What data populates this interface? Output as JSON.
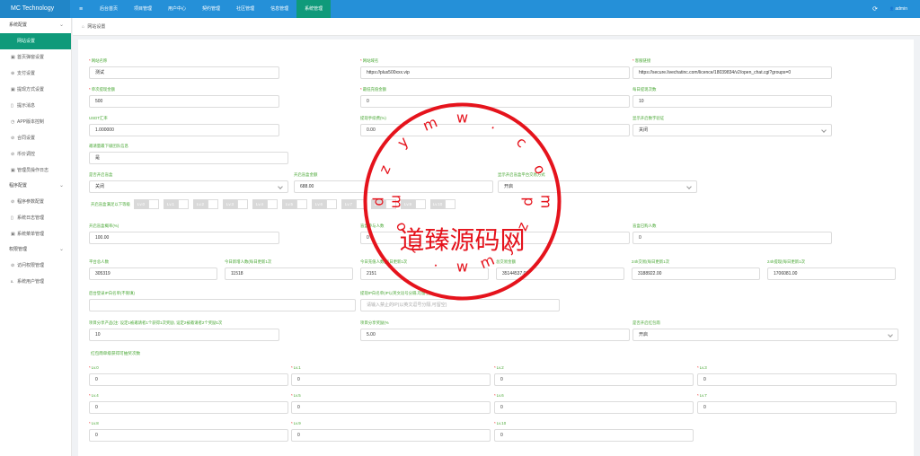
{
  "app": {
    "brand": "MC Technology",
    "menu_icon": "≡"
  },
  "nav": {
    "items": [
      "后台首页",
      "项目管理",
      "用户中心",
      "契约管理",
      "社区管理",
      "信息管理",
      "系统管理"
    ],
    "active_index": 6
  },
  "topright": {
    "refresh_icon": "⟳",
    "user": "admin",
    "user_icon": "👤"
  },
  "sidebar": {
    "group1": "系统配置",
    "items1": [
      {
        "label": "网站设置",
        "icon": "",
        "active": true
      },
      {
        "label": "首页弹窗设置",
        "icon": "▣"
      },
      {
        "label": "支付设置",
        "icon": "⊕"
      },
      {
        "label": "提现方式设置",
        "icon": "▣"
      },
      {
        "label": "提示消息",
        "icon": "▯"
      },
      {
        "label": "APP版本控制",
        "icon": "◷"
      },
      {
        "label": "合同设置",
        "icon": "⊘"
      },
      {
        "label": "币价调控",
        "icon": "⊘"
      },
      {
        "label": "管理员操作日志",
        "icon": "▣"
      }
    ],
    "group2": "程序配置",
    "items2": [
      {
        "label": "程序参数配置",
        "icon": "⊘"
      },
      {
        "label": "系统日志管理",
        "icon": "▯"
      },
      {
        "label": "系统菜单管理",
        "icon": "▣"
      }
    ],
    "group3": "权限管理",
    "items3": [
      {
        "label": "访问权限管理",
        "icon": "⊘"
      },
      {
        "label": "系统用户管理",
        "icon": "ఽ"
      }
    ]
  },
  "tab": {
    "label": "网站设置",
    "icon": "⌂"
  },
  "form": {
    "row1": [
      {
        "label": "网站名称",
        "req": true,
        "value": "测试"
      },
      {
        "label": "网站域名",
        "req": true,
        "value": "https://plus500xxx.vip"
      },
      {
        "label": "客服链接",
        "req": true,
        "value": "https://secure.livechatinc.com/licence/18039834/v2/open_chat.cgi?groups=0"
      }
    ],
    "row2": [
      {
        "label": "单次提现金额",
        "req": true,
        "value": "500"
      },
      {
        "label": "最低充值金额",
        "req": true,
        "value": "0"
      },
      {
        "label": "每日提现次数",
        "req": false,
        "value": "10"
      }
    ],
    "row3": [
      {
        "label": "USDT汇率",
        "req": false,
        "value": "1.000000"
      },
      {
        "label": "提现手续费(%)",
        "req": false,
        "value": "0.00"
      },
      {
        "label": "显示开启数字验证",
        "req": false,
        "value": "关闭",
        "select": true
      }
    ],
    "row4": {
      "label": "邀请量最下级团队信息",
      "value": "是"
    },
    "row5": [
      {
        "label": "是否开启盲盒",
        "value": "关闭",
        "select": true
      },
      {
        "label": "开启盲盒金额",
        "value": "688.00"
      },
      {
        "label": "显示开启盲盒平台交易方式",
        "value": "开启",
        "select": true
      }
    ],
    "tags": {
      "label": "开启盲盒满足以下等级",
      "items": [
        "Lv.0",
        "Lv.1",
        "Lv.2",
        "Lv.3",
        "Lv.4",
        "Lv.5",
        "Lv.6",
        "Lv.7",
        "Lv.8",
        "Lv.9",
        "Lv.10"
      ]
    },
    "row6": [
      {
        "label": "开启盲盒概率(%)",
        "value": "100.00"
      },
      {
        "label": "盲盒参与人数",
        "value": "0"
      },
      {
        "label": "盲盒已购人数",
        "value": "0"
      }
    ],
    "row7": [
      {
        "label": "平台总人数",
        "value": "305319"
      },
      {
        "label": "今日新增人数(每日更新1次",
        "value": "11518"
      },
      {
        "label": "今日充值人数(每日更新1次",
        "value": "2151"
      },
      {
        "label": "总交易金额",
        "value": "35144537.00"
      },
      {
        "label": "24h交易(每日更新1次",
        "value": "3188922.00"
      },
      {
        "label": "24h提现(每日更新1次",
        "value": "1706081.00"
      }
    ],
    "row8": [
      {
        "label": "后台登录IP白名单(不限填)",
        "value": ""
      },
      {
        "label": "提现IP白名单(IP以英文逗号分隔,可留空)",
        "value": "",
        "placeholder": "请输入禁止的IP(以英文逗号分隔,可留空)"
      }
    ],
    "row9": [
      {
        "label": "项目分享产品(注: 设定1被邀请者1个获得1次奖励, 设定2被邀请者2个奖励1次",
        "value": "10"
      },
      {
        "label": "项目分享奖励(%",
        "value": "5.00"
      },
      {
        "label": "是否开启红包雨",
        "value": "开启",
        "select": true
      }
    ],
    "section": "红包雨单级获得可抽奖次数",
    "lv_fields": [
      {
        "label": "Lv.0",
        "value": "0"
      },
      {
        "label": "Lv.1",
        "value": "0"
      },
      {
        "label": "Lv.2",
        "value": "0"
      },
      {
        "label": "Lv.3",
        "value": "0"
      },
      {
        "label": "Lv.4",
        "value": "0"
      },
      {
        "label": "Lv.5",
        "value": "0"
      },
      {
        "label": "Lv.6",
        "value": "0"
      },
      {
        "label": "Lv.7",
        "value": "0"
      },
      {
        "label": "Lv.8",
        "value": "0"
      },
      {
        "label": "Lv.9",
        "value": "0"
      },
      {
        "label": "Lv.10",
        "value": "0"
      }
    ]
  },
  "watermark": {
    "center": "道臻源码网",
    "arc": "dzymw.com",
    "color": "#e5131c"
  }
}
